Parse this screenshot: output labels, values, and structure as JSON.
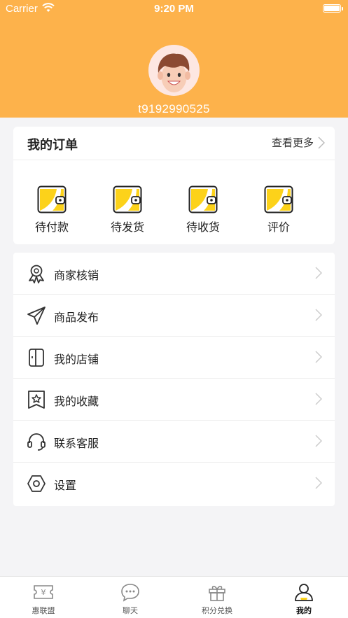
{
  "status_bar": {
    "carrier": "Carrier",
    "time": "9:20 PM"
  },
  "profile": {
    "username": "t9192990525"
  },
  "orders": {
    "title": "我的订单",
    "view_more": "查看更多",
    "items": [
      {
        "label": "待付款",
        "icon": "wallet-icon"
      },
      {
        "label": "待发货",
        "icon": "wallet-icon"
      },
      {
        "label": "待收货",
        "icon": "wallet-icon"
      },
      {
        "label": "评价",
        "icon": "wallet-icon"
      }
    ]
  },
  "menu": [
    {
      "label": "商家核销",
      "icon": "award-icon"
    },
    {
      "label": "商品发布",
      "icon": "paper-plane-icon"
    },
    {
      "label": "我的店铺",
      "icon": "store-icon"
    },
    {
      "label": "我的收藏",
      "icon": "star-bookmark-icon"
    },
    {
      "label": "联系客服",
      "icon": "headset-icon"
    },
    {
      "label": "设置",
      "icon": "settings-hexagon-icon"
    }
  ],
  "tabs": [
    {
      "label": "惠联盟",
      "icon": "ticket-icon",
      "active": false
    },
    {
      "label": "聊天",
      "icon": "chat-bubble-icon",
      "active": false
    },
    {
      "label": "积分兑换",
      "icon": "gift-icon",
      "active": false
    },
    {
      "label": "我的",
      "icon": "user-icon",
      "active": true
    }
  ],
  "colors": {
    "header": "#fdb24b",
    "accent_yellow": "#fcd21a",
    "background": "#f4f4f6"
  }
}
